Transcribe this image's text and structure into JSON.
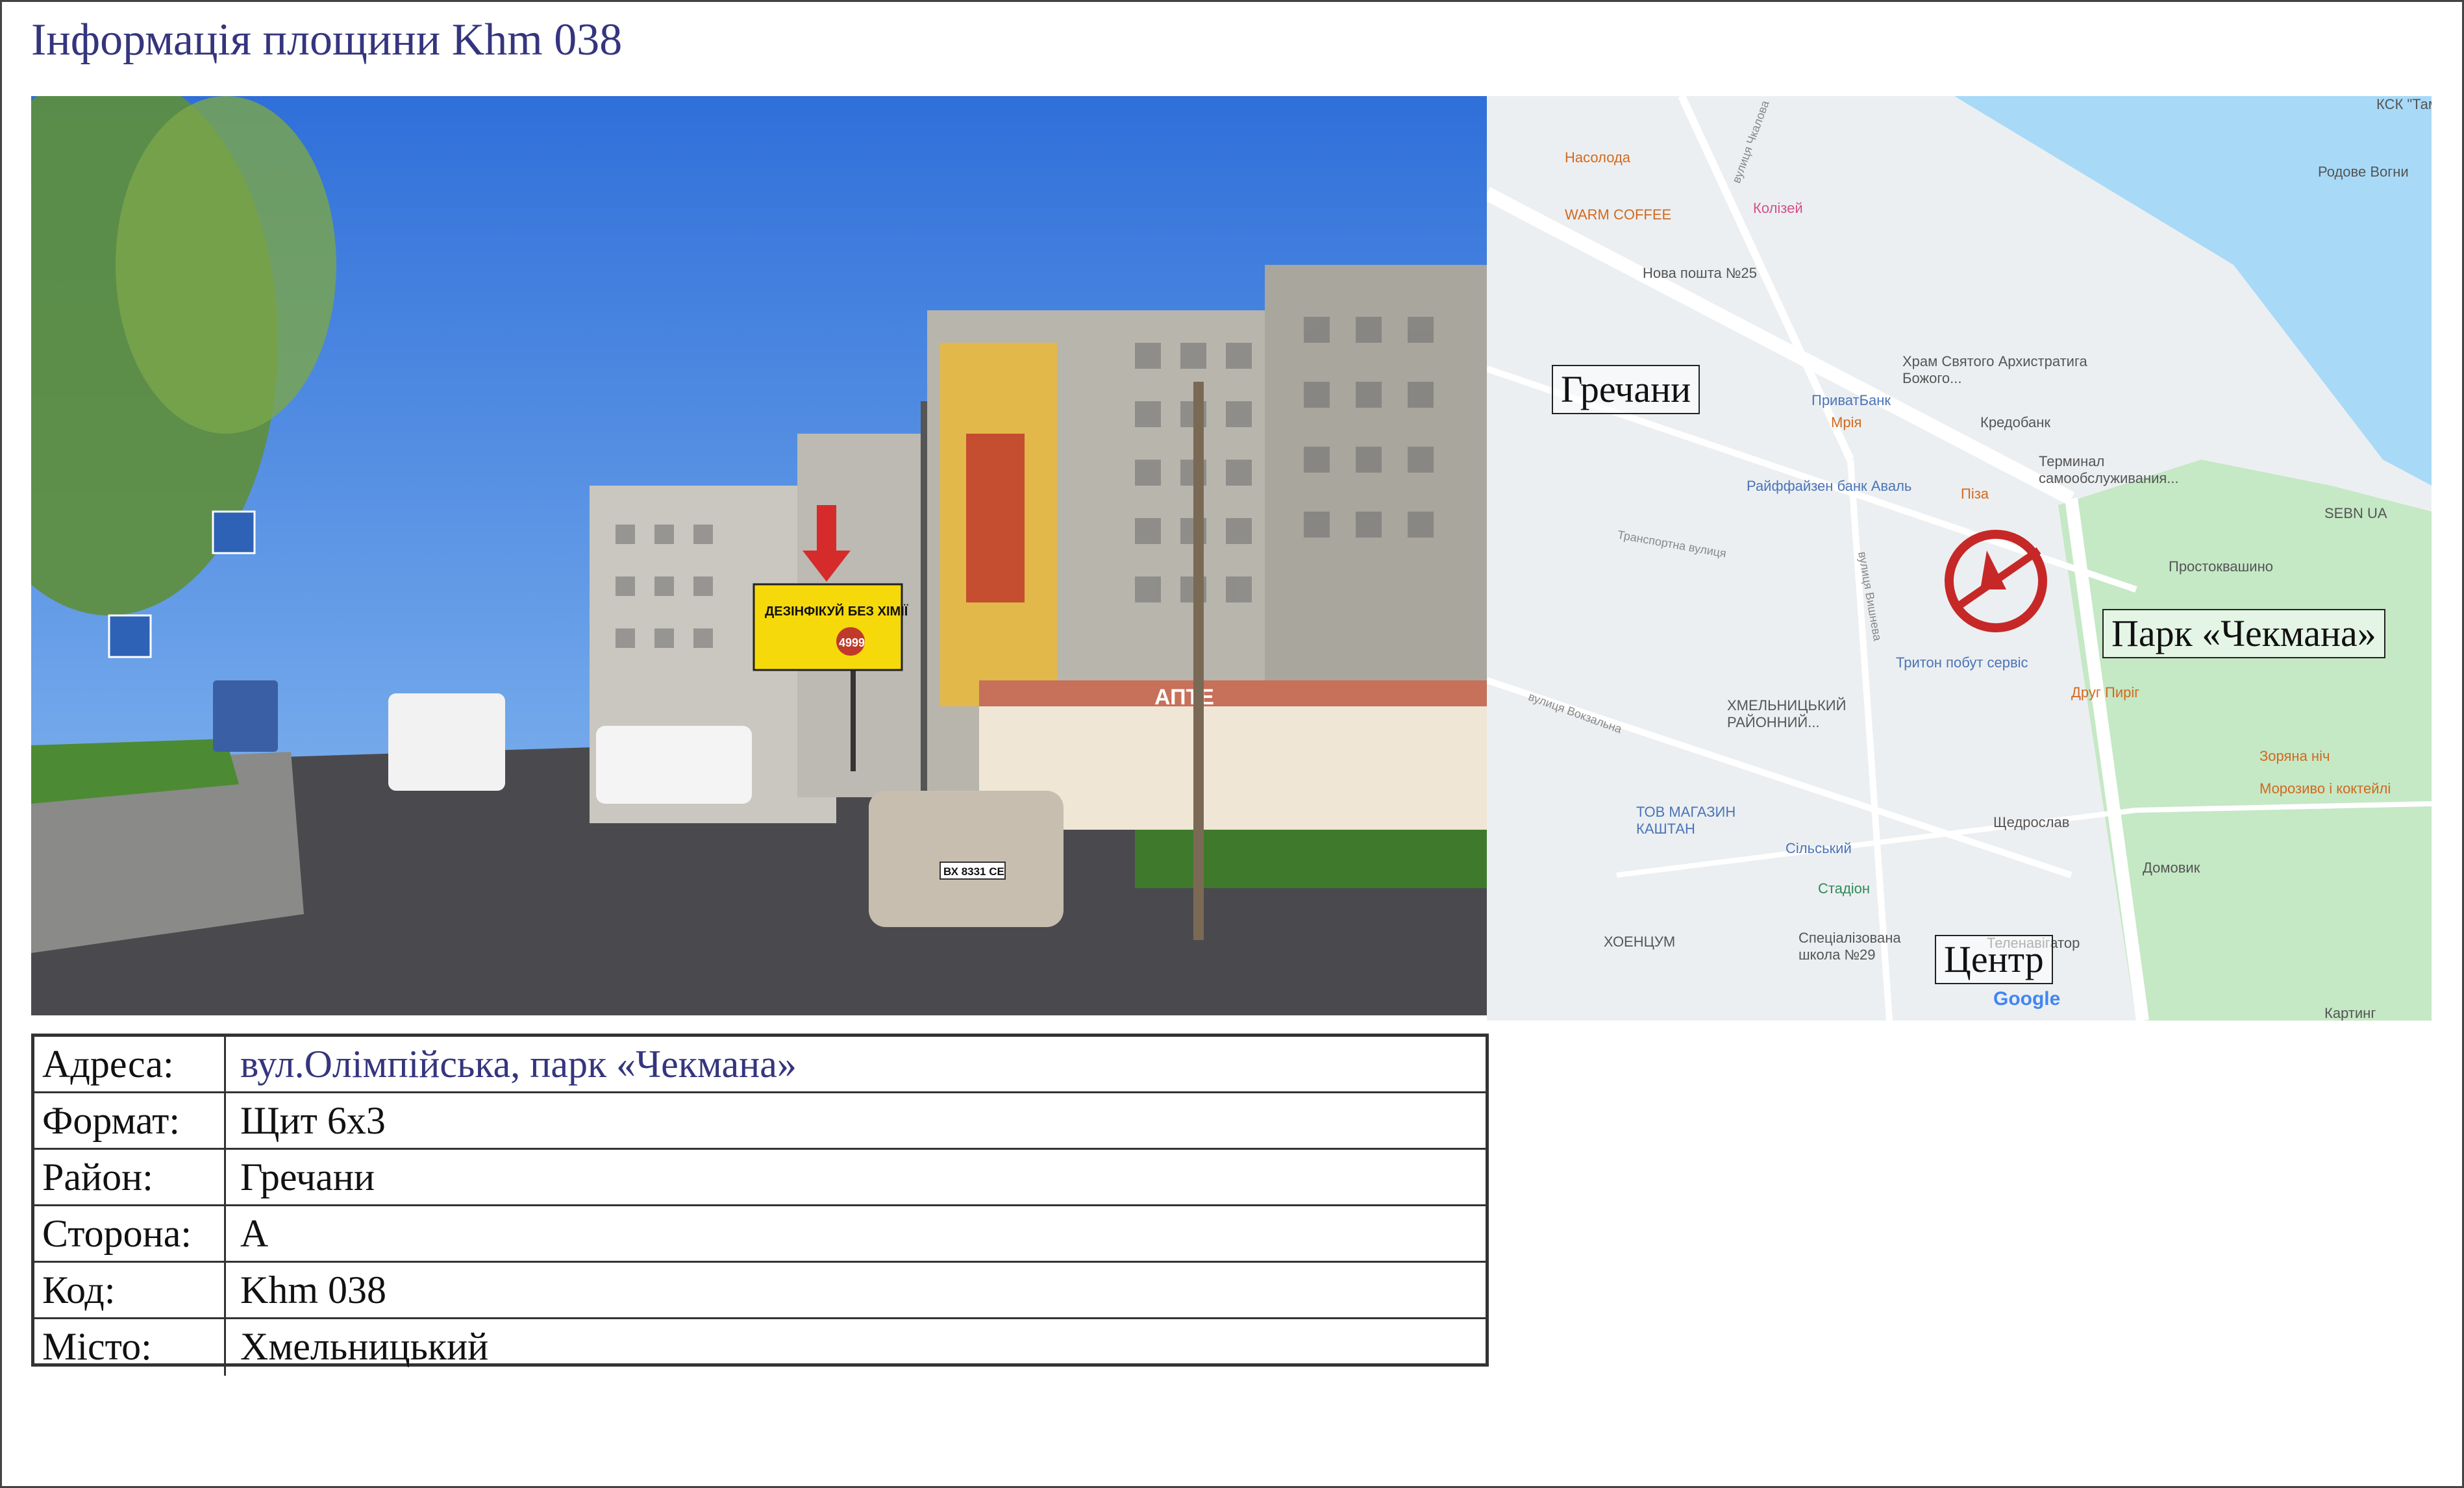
{
  "title": "Інформація площини Khm 038",
  "photo": {
    "billboard_headline": "ДЕЗІНФІКУЙ БЕЗ ХІМІЇ",
    "billboard_price": "4999",
    "shop_sign": "АПТЕ",
    "car_plate": "ВХ 8331 СЕ"
  },
  "map": {
    "box_labels": {
      "grechany": "Гречани",
      "park": "Парк «Чекмана»",
      "center": "Центр"
    },
    "labels": [
      "Насолода",
      "WARM COFFEE",
      "Колізей",
      "Нова пошта №25",
      "Храм Святого Архистратига Божого...",
      "ПриватБанк",
      "Мрія",
      "Кредобанк",
      "Терминал самообслуживания...",
      "Райффайзен банк Аваль",
      "Піза",
      "SEBN UA",
      "Простоквашино",
      "Тритон побут сервіс",
      "Друг Пиріг",
      "ХМЕЛЬНИЦЬКИЙ РАЙОННИЙ...",
      "Зоряна ніч",
      "Морозиво і коктейлі",
      "ТОВ МАГАЗИН КАШТАН",
      "Сільський",
      "Щедрослав",
      "Домовик",
      "Стадіон",
      "ХОЕНЦУМ",
      "Спеціалізована школа №29",
      "Теленавігатор",
      "Родове Вогни",
      "КСК \"Там",
      "Картинг"
    ],
    "streets": [
      "Транспортна вулиця",
      "вулиця Вокзальна",
      "вулиця Вишнева",
      "вулиця Чкалова"
    ],
    "logo": "Google"
  },
  "info": {
    "rows": [
      {
        "label": "Адреса:",
        "value": "вул.Олімпійська, парк «Чекмана»"
      },
      {
        "label": "Формат:",
        "value": "Щит 6х3"
      },
      {
        "label": "Район:",
        "value": "Гречани"
      },
      {
        "label": "Сторона:",
        "value": "А"
      },
      {
        "label": "Код:",
        "value": "Khm 038"
      },
      {
        "label": "Місто:",
        "value": "Хмельницький"
      }
    ]
  },
  "colors": {
    "title": "#35357e",
    "address_value": "#35357e",
    "map_background": "#eceff1",
    "map_water": "#a8daf7",
    "map_park": "#c5e8c5",
    "marker": "#c62828"
  }
}
